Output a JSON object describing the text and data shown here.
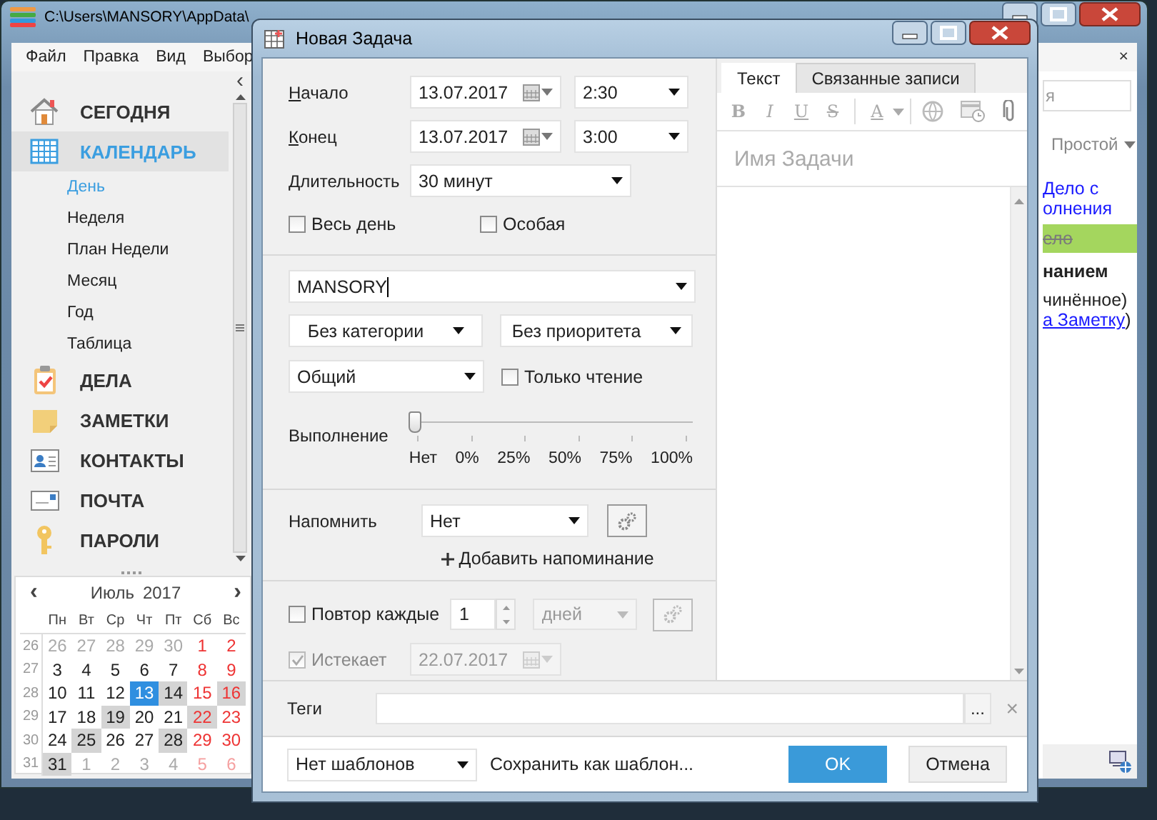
{
  "main_window": {
    "title": "C:\\Users\\MANSORY\\AppData\\",
    "menu": [
      "Файл",
      "Правка",
      "Вид",
      "Выбор"
    ],
    "collapse": "‹"
  },
  "sidebar": {
    "modules": [
      {
        "label": "СЕГОДНЯ",
        "selected": false
      },
      {
        "label": "КАЛЕНДАРЬ",
        "selected": true,
        "children": [
          {
            "label": "День",
            "selected": true
          },
          {
            "label": "Неделя",
            "selected": false
          },
          {
            "label": "План Недели",
            "selected": false
          },
          {
            "label": "Месяц",
            "selected": false
          },
          {
            "label": "Год",
            "selected": false
          },
          {
            "label": "Таблица",
            "selected": false
          }
        ]
      },
      {
        "label": "ДЕЛА",
        "selected": false
      },
      {
        "label": "ЗАМЕТКИ",
        "selected": false
      },
      {
        "label": "КОНТАКТЫ",
        "selected": false
      },
      {
        "label": "ПОЧТА",
        "selected": false
      },
      {
        "label": "ПАРОЛИ",
        "selected": false
      }
    ]
  },
  "mini_calendar": {
    "prev": "‹",
    "next": "›",
    "month": "Июль",
    "year": "2017",
    "weekdays": [
      "Пн",
      "Вт",
      "Ср",
      "Чт",
      "Пт",
      "Сб",
      "Вс"
    ],
    "weeks": [
      {
        "number": "26",
        "days": [
          {
            "day": "26",
            "kind": "other",
            "weekend": false,
            "marked": false,
            "selected": false
          },
          {
            "day": "27",
            "kind": "other",
            "weekend": false,
            "marked": false,
            "selected": false
          },
          {
            "day": "28",
            "kind": "other",
            "weekend": false,
            "marked": false,
            "selected": false
          },
          {
            "day": "29",
            "kind": "other",
            "weekend": false,
            "marked": false,
            "selected": false
          },
          {
            "day": "30",
            "kind": "other",
            "weekend": false,
            "marked": false,
            "selected": false
          },
          {
            "day": "1",
            "kind": "current",
            "weekend": true,
            "marked": false,
            "selected": false
          },
          {
            "day": "2",
            "kind": "current",
            "weekend": true,
            "marked": false,
            "selected": false
          }
        ]
      },
      {
        "number": "27",
        "days": [
          {
            "day": "3",
            "kind": "current",
            "weekend": false,
            "marked": false,
            "selected": false
          },
          {
            "day": "4",
            "kind": "current",
            "weekend": false,
            "marked": false,
            "selected": false
          },
          {
            "day": "5",
            "kind": "current",
            "weekend": false,
            "marked": false,
            "selected": false
          },
          {
            "day": "6",
            "kind": "current",
            "weekend": false,
            "marked": false,
            "selected": false
          },
          {
            "day": "7",
            "kind": "current",
            "weekend": false,
            "marked": false,
            "selected": false
          },
          {
            "day": "8",
            "kind": "current",
            "weekend": true,
            "marked": false,
            "selected": false
          },
          {
            "day": "9",
            "kind": "current",
            "weekend": true,
            "marked": false,
            "selected": false
          }
        ]
      },
      {
        "number": "28",
        "days": [
          {
            "day": "10",
            "kind": "current",
            "weekend": false,
            "marked": false,
            "selected": false
          },
          {
            "day": "11",
            "kind": "current",
            "weekend": false,
            "marked": false,
            "selected": false
          },
          {
            "day": "12",
            "kind": "current",
            "weekend": false,
            "marked": false,
            "selected": false
          },
          {
            "day": "13",
            "kind": "current",
            "weekend": false,
            "marked": false,
            "selected": true
          },
          {
            "day": "14",
            "kind": "current",
            "weekend": false,
            "marked": true,
            "selected": false
          },
          {
            "day": "15",
            "kind": "current",
            "weekend": true,
            "marked": false,
            "selected": false
          },
          {
            "day": "16",
            "kind": "current",
            "weekend": true,
            "marked": true,
            "selected": false
          }
        ]
      },
      {
        "number": "29",
        "days": [
          {
            "day": "17",
            "kind": "current",
            "weekend": false,
            "marked": false,
            "selected": false
          },
          {
            "day": "18",
            "kind": "current",
            "weekend": false,
            "marked": false,
            "selected": false
          },
          {
            "day": "19",
            "kind": "current",
            "weekend": false,
            "marked": true,
            "selected": false
          },
          {
            "day": "20",
            "kind": "current",
            "weekend": false,
            "marked": false,
            "selected": false
          },
          {
            "day": "21",
            "kind": "current",
            "weekend": false,
            "marked": false,
            "selected": false
          },
          {
            "day": "22",
            "kind": "current",
            "weekend": true,
            "marked": true,
            "selected": false
          },
          {
            "day": "23",
            "kind": "current",
            "weekend": true,
            "marked": false,
            "selected": false
          }
        ]
      },
      {
        "number": "30",
        "days": [
          {
            "day": "24",
            "kind": "current",
            "weekend": false,
            "marked": false,
            "selected": false
          },
          {
            "day": "25",
            "kind": "current",
            "weekend": false,
            "marked": true,
            "selected": false
          },
          {
            "day": "26",
            "kind": "current",
            "weekend": false,
            "marked": false,
            "selected": false
          },
          {
            "day": "27",
            "kind": "current",
            "weekend": false,
            "marked": false,
            "selected": false
          },
          {
            "day": "28",
            "kind": "current",
            "weekend": false,
            "marked": true,
            "selected": false
          },
          {
            "day": "29",
            "kind": "current",
            "weekend": true,
            "marked": false,
            "selected": false
          },
          {
            "day": "30",
            "kind": "current",
            "weekend": true,
            "marked": false,
            "selected": false
          }
        ]
      },
      {
        "number": "31",
        "days": [
          {
            "day": "31",
            "kind": "current",
            "weekend": false,
            "marked": true,
            "selected": false
          },
          {
            "day": "1",
            "kind": "other",
            "weekend": false,
            "marked": false,
            "selected": false
          },
          {
            "day": "2",
            "kind": "other",
            "weekend": false,
            "marked": false,
            "selected": false
          },
          {
            "day": "3",
            "kind": "other",
            "weekend": false,
            "marked": false,
            "selected": false
          },
          {
            "day": "4",
            "kind": "other",
            "weekend": false,
            "marked": false,
            "selected": false
          },
          {
            "day": "5",
            "kind": "other",
            "weekend": true,
            "marked": false,
            "selected": false
          },
          {
            "day": "6",
            "kind": "other",
            "weekend": true,
            "marked": false,
            "selected": false
          }
        ]
      }
    ]
  },
  "right_panel": {
    "close": "×",
    "search": {
      "placeholder": "я"
    },
    "view": "Простой",
    "items": [
      {
        "kind": "link",
        "text": "Дело с"
      },
      {
        "kind": "link",
        "text": "олнения"
      },
      {
        "kind": "done",
        "text": "ело"
      },
      {
        "kind": "bold",
        "text": "нанием"
      },
      {
        "kind": "plain",
        "text": "чинённое)"
      },
      {
        "kind": "linked",
        "text": "а Заметку",
        "after": ")"
      }
    ]
  },
  "dialog": {
    "title": "Новая Задача",
    "start": {
      "label": "Начало",
      "date": "13.07.2017",
      "time": "2:30"
    },
    "end": {
      "label": "Конец",
      "date": "13.07.2017",
      "time": "3:00"
    },
    "duration": {
      "label": "Длительность",
      "value": "30 минут"
    },
    "all_day": {
      "label": "Весь день",
      "checked": false
    },
    "special": {
      "label": "Особая",
      "checked": false
    },
    "owner": {
      "value": "MANSORY"
    },
    "category": "Без категории",
    "priority": "Без приоритета",
    "access": "Общий",
    "read_only": {
      "label": "Только чтение",
      "checked": false
    },
    "progress": {
      "label": "Выполнение",
      "level": 0,
      "ticks": [
        "Нет",
        "0%",
        "25%",
        "50%",
        "75%",
        "100%"
      ]
    },
    "reminder": {
      "label": "Напомнить",
      "value": "Нет",
      "add": "Добавить напоминание"
    },
    "repeat": {
      "label": "Повтор каждые",
      "checked": false,
      "count": "1",
      "unit": "дней",
      "disabled": true
    },
    "expires": {
      "label": "Истекает",
      "checked": true,
      "disabled": true,
      "date": "22.07.2017"
    },
    "tabs": [
      {
        "label": "Текст",
        "selected": true
      },
      {
        "label": "Связанные записи",
        "selected": false
      }
    ],
    "format_buttons": [
      "B",
      "I",
      "U",
      "S",
      "A"
    ],
    "name_placeholder": "Имя Задачи",
    "tags": {
      "label": "Теги",
      "browse": "...",
      "clear": "×"
    },
    "template": {
      "value": "Нет шаблонов",
      "save": "Сохранить как шаблон..."
    },
    "buttons": [
      {
        "label": "OK",
        "primary": true
      },
      {
        "label": "Отмена",
        "primary": false
      }
    ]
  }
}
